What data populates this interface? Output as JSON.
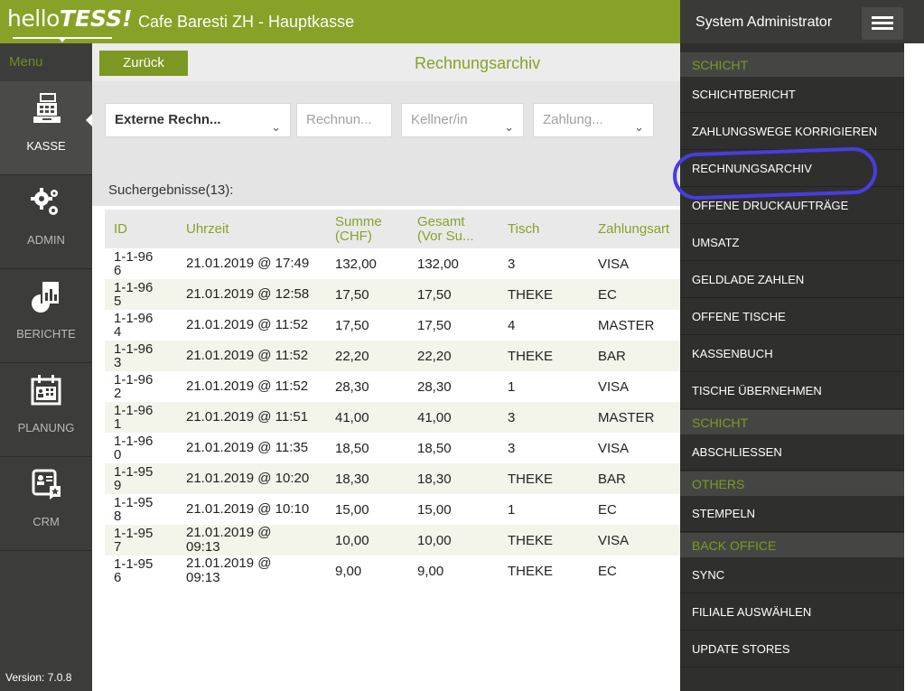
{
  "brand": {
    "hello": "hello",
    "tess": "TESS!"
  },
  "store_title": "Cafe Baresti ZH - Hauptkasse",
  "user": {
    "name": "System Administrator"
  },
  "sidebar": {
    "menu_label": "Menu",
    "items": [
      {
        "label": "KASSE",
        "icon": "cash-register-icon",
        "active": true
      },
      {
        "label": "ADMIN",
        "icon": "gears-icon",
        "active": false
      },
      {
        "label": "BERICHTE",
        "icon": "report-chart-icon",
        "active": false
      },
      {
        "label": "PLANUNG",
        "icon": "calendar-icon",
        "active": false
      },
      {
        "label": "CRM",
        "icon": "customer-card-icon",
        "active": false
      }
    ],
    "version": "Version: 7.0.8"
  },
  "main": {
    "back_label": "Zurück",
    "title": "Rechnungsarchiv",
    "filters": {
      "type_value": "Externe Rechn...",
      "number_placeholder": "Rechnun...",
      "waiter_placeholder": "Kellner/in",
      "payment_placeholder": "Zahlung..."
    },
    "results_label": "Suchergebnisse(13):",
    "columns": [
      "ID",
      "Uhrzeit",
      "Summe (CHF)",
      "Gesamt (Vor Su...",
      "Tisch",
      "Zahlungsart"
    ],
    "rows": [
      {
        "id": "1-1-96 6",
        "time": "21.01.2019 @ 17:49",
        "sum": "132,00",
        "total": "132,00",
        "table": "3",
        "payment": "VISA"
      },
      {
        "id": "1-1-96 5",
        "time": "21.01.2019 @ 12:58",
        "sum": "17,50",
        "total": "17,50",
        "table": "THEKE",
        "payment": "EC"
      },
      {
        "id": "1-1-96 4",
        "time": "21.01.2019 @ 11:52",
        "sum": "17,50",
        "total": "17,50",
        "table": "4",
        "payment": "MASTER"
      },
      {
        "id": "1-1-96 3",
        "time": "21.01.2019 @ 11:52",
        "sum": "22,20",
        "total": "22,20",
        "table": "THEKE",
        "payment": "BAR"
      },
      {
        "id": "1-1-96 2",
        "time": "21.01.2019 @ 11:52",
        "sum": "28,30",
        "total": "28,30",
        "table": "1",
        "payment": "VISA"
      },
      {
        "id": "1-1-96 1",
        "time": "21.01.2019 @ 11:51",
        "sum": "41,00",
        "total": "41,00",
        "table": "3",
        "payment": "MASTER"
      },
      {
        "id": "1-1-96 0",
        "time": "21.01.2019 @ 11:35",
        "sum": "18,50",
        "total": "18,50",
        "table": "3",
        "payment": "VISA"
      },
      {
        "id": "1-1-95 9",
        "time": "21.01.2019 @ 10:20",
        "sum": "18,30",
        "total": "18,30",
        "table": "THEKE",
        "payment": "BAR"
      },
      {
        "id": "1-1-95 8",
        "time": "21.01.2019 @ 10:10",
        "sum": "15,00",
        "total": "15,00",
        "table": "1",
        "payment": "EC"
      },
      {
        "id": "1-1-95 7",
        "time": "21.01.2019 @ 09:13",
        "sum": "10,00",
        "total": "10,00",
        "table": "THEKE",
        "payment": "VISA"
      },
      {
        "id": "1-1-95 6",
        "time": "21.01.2019 @ 09:13",
        "sum": "9,00",
        "total": "9,00",
        "table": "THEKE",
        "payment": "EC"
      }
    ]
  },
  "dropdown": {
    "entries": [
      {
        "kind": "section",
        "label": "SCHICHT"
      },
      {
        "kind": "item",
        "label": "SCHICHTBERICHT"
      },
      {
        "kind": "item",
        "label": "ZAHLUNGSWEGE KORRIGIEREN"
      },
      {
        "kind": "item",
        "label": "RECHNUNGSARCHIV"
      },
      {
        "kind": "item",
        "label": "OFFENE DRUCKAUFTRÄGE"
      },
      {
        "kind": "item",
        "label": "UMSATZ"
      },
      {
        "kind": "item",
        "label": "GELDLADE ZAHLEN"
      },
      {
        "kind": "item",
        "label": "OFFENE TISCHE"
      },
      {
        "kind": "item",
        "label": "KASSENBUCH"
      },
      {
        "kind": "item",
        "label": "TISCHE ÜBERNEHMEN"
      },
      {
        "kind": "section",
        "label": "SCHICHT"
      },
      {
        "kind": "item",
        "label": "ABSCHLIESSEN"
      },
      {
        "kind": "section",
        "label": "OTHERS"
      },
      {
        "kind": "item",
        "label": "STEMPELN"
      },
      {
        "kind": "section",
        "label": "BACK OFFICE"
      },
      {
        "kind": "item",
        "label": "SYNC"
      },
      {
        "kind": "item",
        "label": "FILIALE AUSWÄHLEN"
      },
      {
        "kind": "item",
        "label": "UPDATE STORES"
      }
    ]
  },
  "colors": {
    "brand_green": "#87a226",
    "accent_green": "#7c9822",
    "menu_dark": "#2f302e",
    "sidebar_dark": "#3c3d3b",
    "highlight_ring": "#4a3ce0"
  }
}
